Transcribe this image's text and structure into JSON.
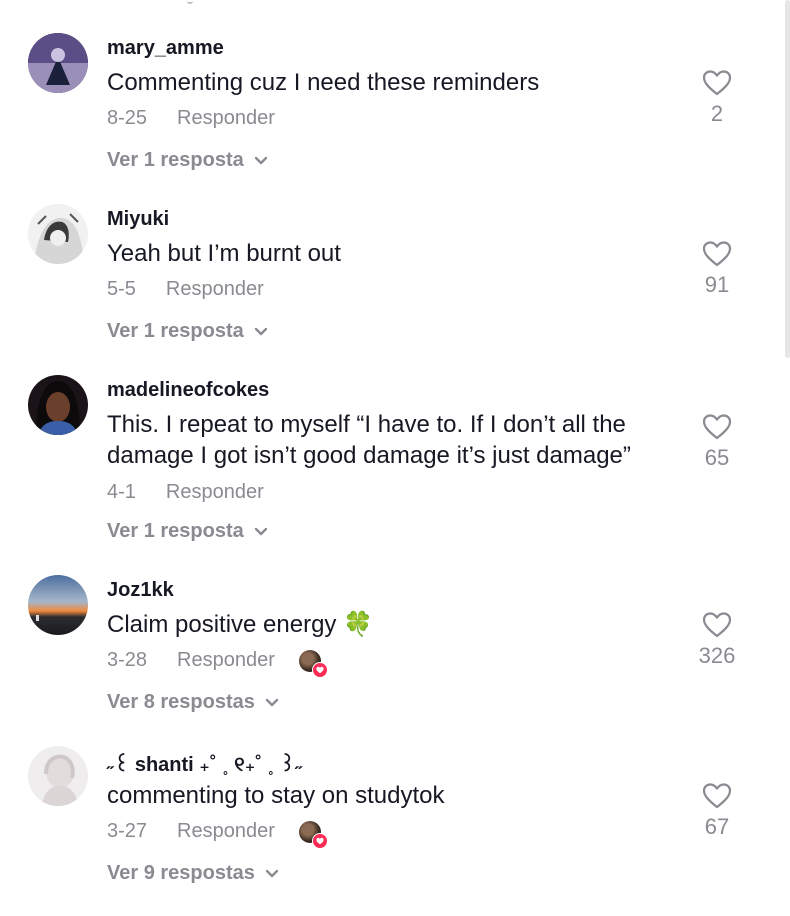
{
  "comments": [
    {
      "username": "mary_amme",
      "text": "Commenting cuz I need these reminders",
      "date": "8-25",
      "reply_label": "Responder",
      "view_replies": "Ver 1 resposta",
      "likes": "2",
      "creator_liked": false
    },
    {
      "username": "Miyuki",
      "text": "Yeah but I’m burnt out",
      "date": "5-5",
      "reply_label": "Responder",
      "view_replies": "Ver 1 resposta",
      "likes": "91",
      "creator_liked": false
    },
    {
      "username": "madelineofcokes",
      "text": "This. I repeat to myself “I have to. If I don’t all the damage I got isn’t good damage it’s just damage”",
      "date": "4-1",
      "reply_label": "Responder",
      "view_replies": "Ver 1 resposta",
      "likes": "65",
      "creator_liked": false
    },
    {
      "username": "Joz1kk",
      "text": "Claim positive energy 🍀",
      "date": "3-28",
      "reply_label": "Responder",
      "view_replies": "Ver 8 respostas",
      "likes": "326",
      "creator_liked": true
    },
    {
      "username": "˶꒰ shanti ₊˚ ˳ ୧₊˚ ˳ ꒱˶",
      "text": "commenting to stay on studytok",
      "date": "3-27",
      "reply_label": "Responder",
      "view_replies": "Ver 9 respostas",
      "likes": "67",
      "creator_liked": true
    }
  ],
  "icons": {
    "like": "heart-outline-icon",
    "expand": "chevron-down-icon",
    "creator_like_badge": "heart-icon"
  },
  "colors": {
    "primary_text": "#161823",
    "secondary_text": "#8a8b91",
    "heart_badge": "#fe2c55"
  }
}
